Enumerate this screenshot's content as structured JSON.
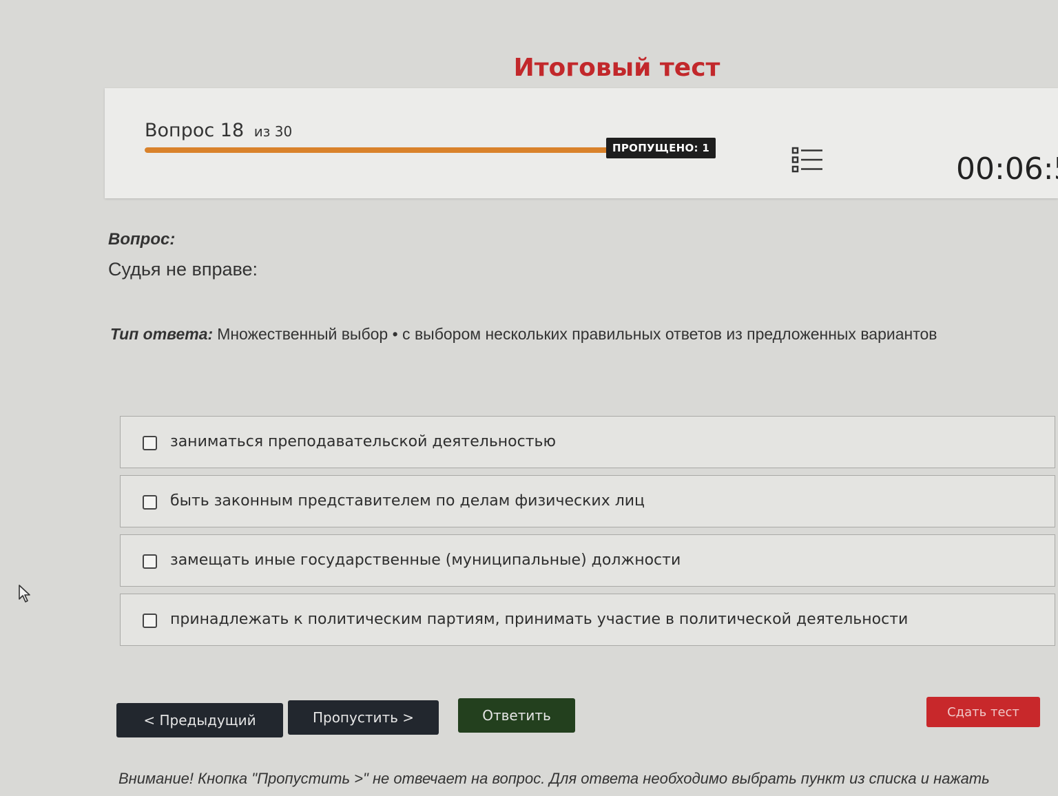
{
  "page": {
    "title": "Итоговый тест"
  },
  "header": {
    "question_word": "Вопрос",
    "question_number": "18",
    "question_of": "из 30",
    "progress": 0.97,
    "skipped_badge": "ПРОПУЩЕНО: 1",
    "list_icon": "question-list-icon",
    "timer": "00:06:5"
  },
  "question": {
    "label": "Вопрос:",
    "text": "Судья не вправе:",
    "answer_type_label": "Тип ответа:",
    "answer_type_value": "Множественный выбор • с выбором нескольких правильных ответов из предложенных вариантов"
  },
  "options": [
    {
      "text": "заниматься преподавательской деятельностью",
      "checked": false
    },
    {
      "text": "быть законным представителем по делам физических лиц",
      "checked": false
    },
    {
      "text": "замещать иные государственные (муниципальные) должности",
      "checked": false
    },
    {
      "text": "принадлежать к политическим партиям, принимать участие в политической деятельности",
      "checked": false
    }
  ],
  "buttons": {
    "prev": "< Предыдущий",
    "skip": "Пропустить >",
    "answer": "Ответить",
    "submit": "Сдать тест"
  },
  "notice": "Внимание! Кнопка \"Пропустить >\" не отвечает на вопрос. Для ответа необходимо выбрать пункт из списка и нажать",
  "colors": {
    "accent_red": "#c2282b",
    "progress": "#d9822b",
    "answer_green": "#23401e",
    "dark_button": "#22272e"
  }
}
